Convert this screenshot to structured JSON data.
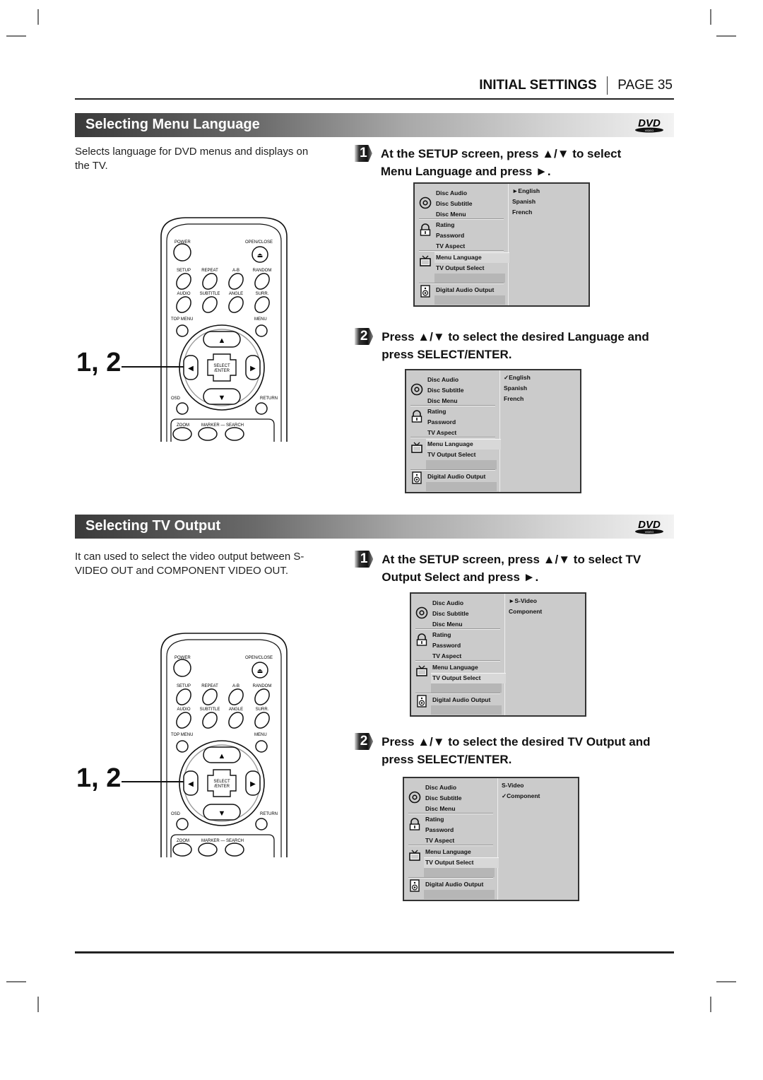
{
  "header": {
    "section": "INITIAL SETTINGS",
    "page": "PAGE 35"
  },
  "sections": [
    {
      "title": "Selecting Menu Language",
      "logo": "dvd-video-logo",
      "intro": "Selects language for DVD menus and displays on the TV.",
      "callout": "1, 2",
      "steps": [
        {
          "num": "1",
          "text": "At the SETUP screen, press ▲/▼ to select  Menu Language   and press ►."
        },
        {
          "num": "2",
          "text": "Press ▲/▼ to select the desired Language and press SELECT/ENTER."
        }
      ],
      "screens": [
        {
          "options": [
            "►English",
            "Spanish",
            "French"
          ]
        },
        {
          "options": [
            "✓English",
            "Spanish",
            "French"
          ]
        }
      ]
    },
    {
      "title": "Selecting TV Output",
      "logo": "dvd-video-logo",
      "intro": "It can used to select the video output between S-VIDEO OUT and COMPONENT VIDEO OUT.",
      "callout": "1, 2",
      "steps": [
        {
          "num": "1",
          "text": "At the SETUP screen, press ▲/▼ to select  TV Output Select   and press ►."
        },
        {
          "num": "2",
          "text": "Press ▲/▼ to select the desired TV Output and press SELECT/ENTER."
        }
      ],
      "screens": [
        {
          "options": [
            "►S-Video",
            "Component"
          ]
        },
        {
          "options": [
            "S-Video",
            "✓Component"
          ]
        }
      ]
    }
  ],
  "menu_items": [
    "Disc Audio",
    "Disc Subtitle",
    "Disc Menu",
    "Rating",
    "Password",
    "TV Aspect",
    "Menu Language",
    "TV Output Select",
    "Digital Audio Output"
  ],
  "remote": {
    "power": "POWER",
    "open_close": "OPEN/CLOSE",
    "row1": [
      "SETUP",
      "REPEAT",
      "A-B",
      "RANDOM"
    ],
    "row2": [
      "AUDIO",
      "SUBTITLE",
      "ANGLE",
      "SURR."
    ],
    "top_menu": "TOP MENU",
    "menu": "MENU",
    "select": "SELECT",
    "enter": "/ENTER",
    "osd": "OSD",
    "return": "RETURN",
    "zoom": "ZOOM",
    "marker_search": "MARKER — SEARCH"
  }
}
